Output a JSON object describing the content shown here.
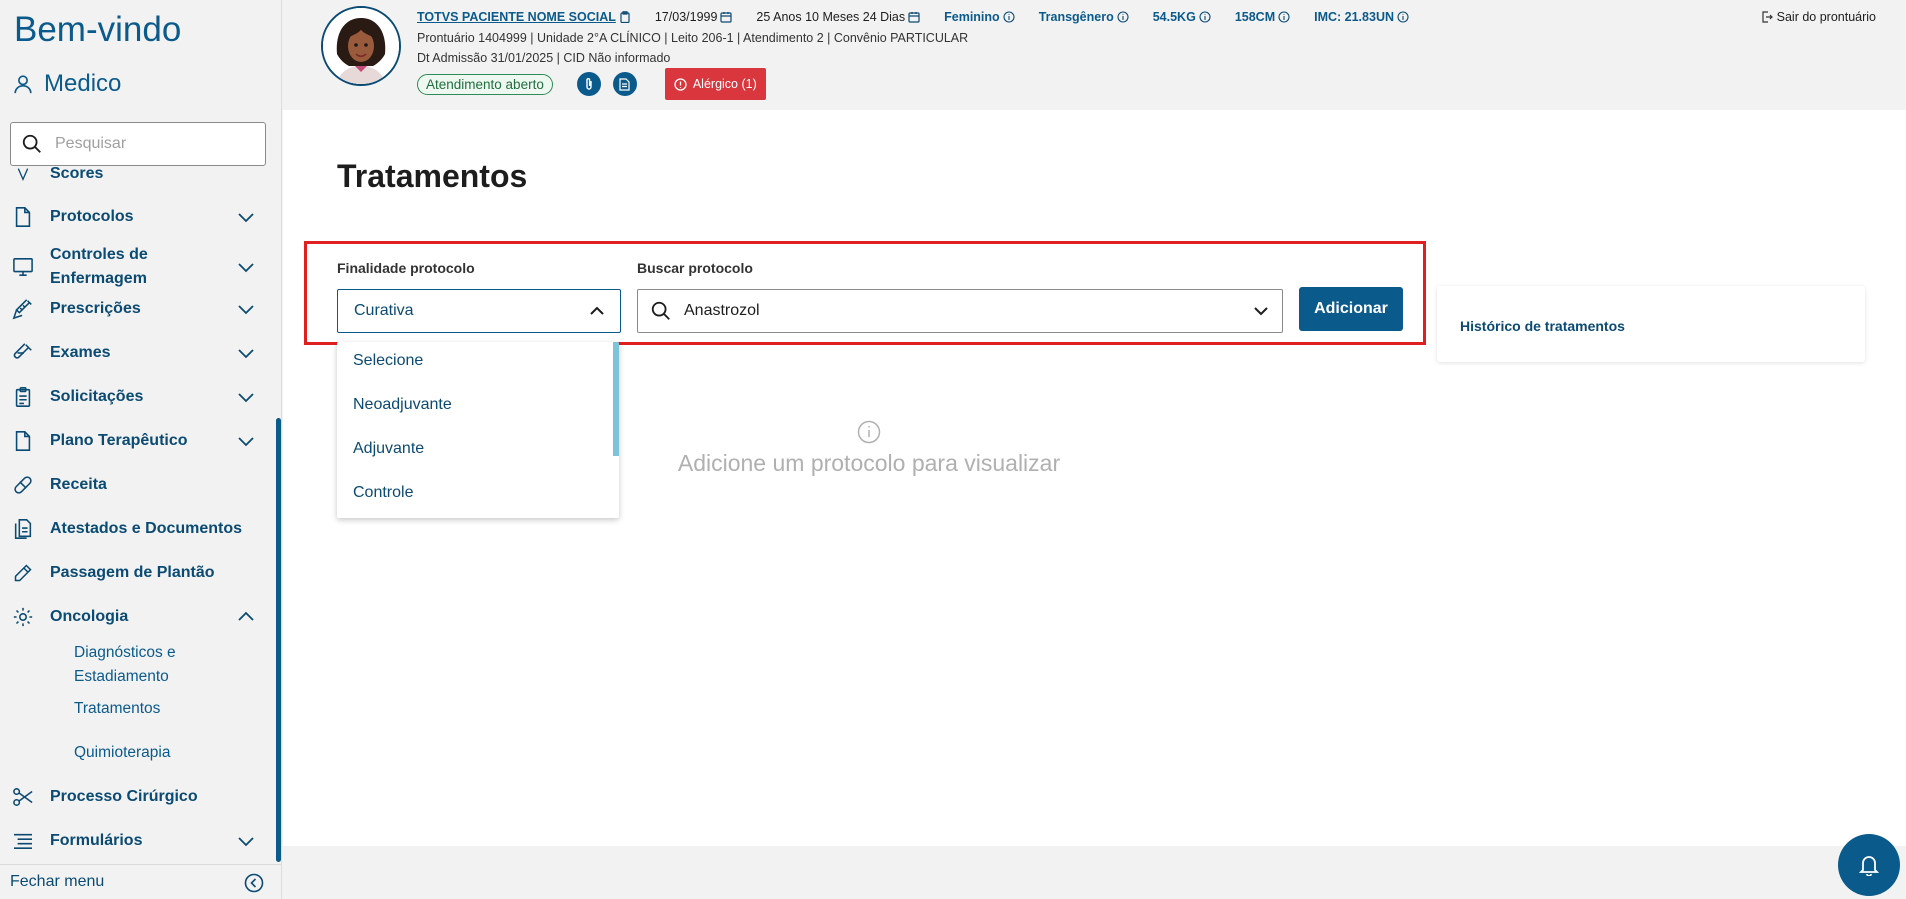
{
  "sidebar": {
    "welcome": "Bem-vindo",
    "role": "Medico",
    "search_placeholder": "Pesquisar",
    "items": [
      {
        "label": "Scores"
      },
      {
        "label": "Protocolos"
      },
      {
        "label": "Controles de Enfermagem"
      },
      {
        "label": "Prescrições"
      },
      {
        "label": "Exames"
      },
      {
        "label": "Solicitações"
      },
      {
        "label": "Plano Terapêutico"
      },
      {
        "label": "Receita"
      },
      {
        "label": "Atestados e Documentos"
      },
      {
        "label": "Passagem de Plantão"
      },
      {
        "label": "Oncologia"
      },
      {
        "label": "Processo Cirúrgico"
      },
      {
        "label": "Formulários"
      }
    ],
    "oncologia_sub": [
      "Diagnósticos e Estadiamento",
      "Tratamentos",
      "Quimioterapia"
    ],
    "close_menu": "Fechar menu"
  },
  "header": {
    "patient_name": "TOTVS PACIENTE NOME SOCIAL",
    "birth_date": "17/03/1999",
    "age": "25 Anos 10 Meses 24 Dias",
    "gender": "Feminino",
    "identity": "Transgênero",
    "weight": "54.5KG",
    "height": "158CM",
    "imc": "IMC: 21.83UN",
    "line2": "Prontuário 1404999  |  Unidade 2°A CLÍNICO  |  Leito 206-1  |  Atendimento 2  |  Convênio PARTICULAR",
    "line3": "Dt Admissão 31/01/2025  |  CID Não informado",
    "status_badge": "Atendimento aberto",
    "allergy": "Alérgico (1)",
    "exit": "Sair do prontuário"
  },
  "main": {
    "title": "Tratamentos",
    "finalidade_label": "Finalidade protocolo",
    "finalidade_value": "Curativa",
    "buscar_label": "Buscar protocolo",
    "buscar_value": "Anastrozol",
    "add_button": "Adicionar",
    "dropdown_options": [
      "Selecione",
      "Neoadjuvante",
      "Adjuvante",
      "Controle"
    ],
    "empty_message": "Adicione um protocolo para visualizar",
    "history_link": "Histórico de tratamentos"
  },
  "colors": {
    "primary": "#0b5a8c",
    "danger": "#d9363e",
    "highlight": "#e02020",
    "success": "#2e8b57"
  }
}
